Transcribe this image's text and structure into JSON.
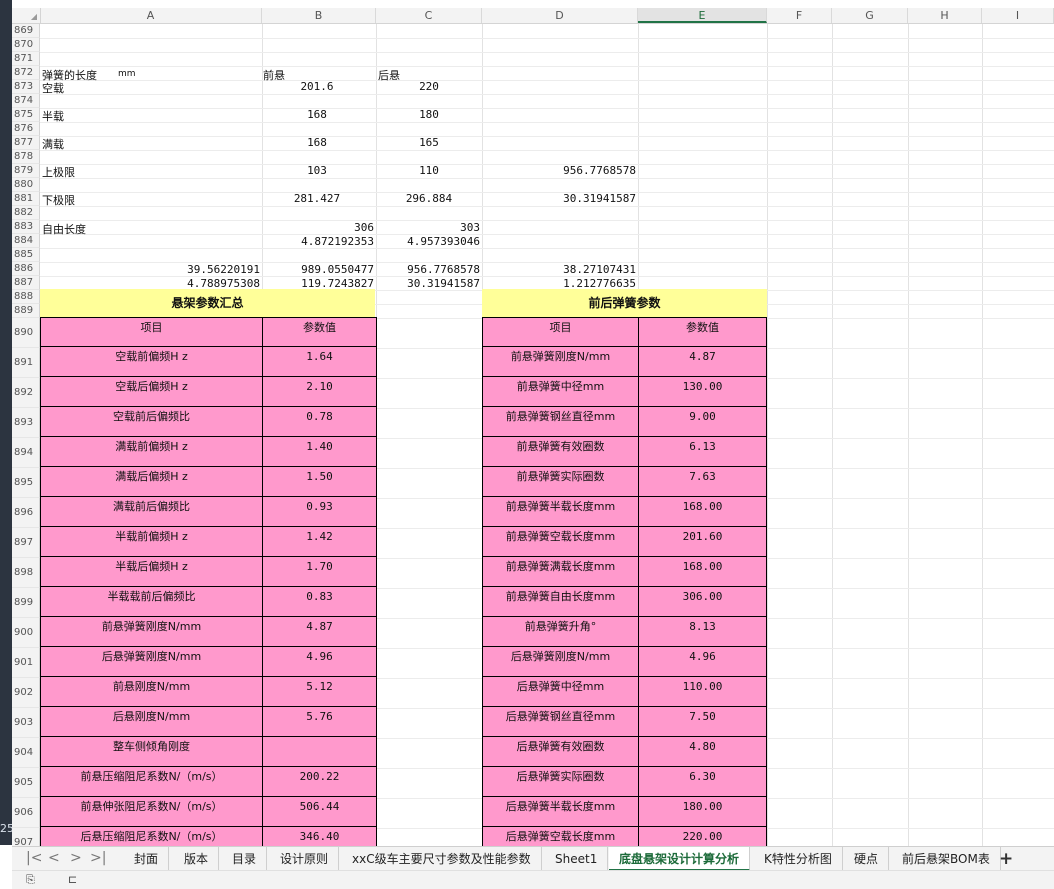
{
  "grid": {
    "columns": [
      "A",
      "B",
      "C",
      "D",
      "E",
      "F",
      "G",
      "H",
      "I"
    ],
    "selected_column": "E",
    "rows": [
      "869",
      "870",
      "871",
      "872",
      "873",
      "874",
      "875",
      "876",
      "877",
      "878",
      "879",
      "880",
      "881",
      "882",
      "883",
      "884",
      "885",
      "886",
      "887",
      "888",
      "889",
      "890",
      "891",
      "892",
      "893",
      "894",
      "895",
      "896",
      "897",
      "898",
      "899",
      "900",
      "901",
      "902",
      "903",
      "904",
      "905",
      "906",
      "907"
    ]
  },
  "spring_length": {
    "label": "弹簧的长度",
    "unit": "mm",
    "front_label": "前悬",
    "rear_label": "后悬",
    "rows": [
      {
        "label": "空载",
        "front": "201.6",
        "rear": "220",
        "extra": ""
      },
      {
        "label": "半载",
        "front": "168",
        "rear": "180",
        "extra": ""
      },
      {
        "label": "满载",
        "front": "168",
        "rear": "165",
        "extra": ""
      },
      {
        "label": "上极限",
        "front": "103",
        "rear": "110",
        "extra": "956.7768578"
      },
      {
        "label": "下极限",
        "front": "281.427",
        "rear": "296.884",
        "extra": "30.31941587"
      }
    ],
    "free_label": "自由长度",
    "free_front": "306",
    "free_rear": "303",
    "r884_b": "4.872192353",
    "r884_c": "4.957393046",
    "r886": [
      "39.56220191",
      "989.0550477",
      "956.7768578",
      "38.27107431"
    ],
    "r887": [
      "4.788975308",
      "119.7243827",
      "30.31941587",
      "1.212776635"
    ]
  },
  "summary_table": {
    "title": "悬架参数汇总",
    "col_item": "项目",
    "col_value": "参数值",
    "rows": [
      {
        "name": "空载前偏频H z",
        "value": "1.64"
      },
      {
        "name": "空载后偏频H z",
        "value": "2.10"
      },
      {
        "name": "空载前后偏频比",
        "value": "0.78"
      },
      {
        "name": "满载前偏频H z",
        "value": "1.40"
      },
      {
        "name": "满载后偏频H z",
        "value": "1.50"
      },
      {
        "name": "满载前后偏频比",
        "value": "0.93"
      },
      {
        "name": "半载前偏频H z",
        "value": "1.42"
      },
      {
        "name": "半载后偏频H z",
        "value": "1.70"
      },
      {
        "name": "半载载前后偏频比",
        "value": "0.83"
      },
      {
        "name": "前悬弹簧刚度N/mm",
        "value": "4.87"
      },
      {
        "name": "后悬弹簧刚度N/mm",
        "value": "4.96"
      },
      {
        "name": "前悬刚度N/mm",
        "value": "5.12"
      },
      {
        "name": "后悬刚度N/mm",
        "value": "5.76"
      },
      {
        "name": "整车侧倾角刚度",
        "value": ""
      },
      {
        "name": "前悬压缩阻尼系数N/（m/s）",
        "value": "200.22"
      },
      {
        "name": "前悬伸张阻尼系数N/（m/s）",
        "value": "506.44"
      },
      {
        "name": "后悬压缩阻尼系数N/（m/s）",
        "value": "346.40"
      }
    ]
  },
  "spring_table": {
    "title": "前后弹簧参数",
    "col_item": "项目",
    "col_value": "参数值",
    "rows": [
      {
        "name": "前悬弹簧刚度N/mm",
        "value": "4.87"
      },
      {
        "name": "前悬弹簧中径mm",
        "value": "130.00"
      },
      {
        "name": "前悬弹簧钢丝直径mm",
        "value": "9.00"
      },
      {
        "name": "前悬弹簧有效圈数",
        "value": "6.13"
      },
      {
        "name": "前悬弹簧实际圈数",
        "value": "7.63"
      },
      {
        "name": "前悬弹簧半载长度mm",
        "value": "168.00"
      },
      {
        "name": "前悬弹簧空载长度mm",
        "value": "201.60"
      },
      {
        "name": "前悬弹簧满载长度mm",
        "value": "168.00"
      },
      {
        "name": "前悬弹簧自由长度mm",
        "value": "306.00"
      },
      {
        "name": "前悬弹簧升角°",
        "value": "8.13"
      },
      {
        "name": "后悬弹簧刚度N/mm",
        "value": "4.96"
      },
      {
        "name": "后悬弹簧中径mm",
        "value": "110.00"
      },
      {
        "name": "后悬弹簧钢丝直径mm",
        "value": "7.50"
      },
      {
        "name": "后悬弹簧有效圈数",
        "value": "4.80"
      },
      {
        "name": "后悬弹簧实际圈数",
        "value": "6.30"
      },
      {
        "name": "后悬弹簧半载长度mm",
        "value": "180.00"
      },
      {
        "name": "后悬弹簧空载长度mm",
        "value": "220.00"
      }
    ]
  },
  "sheet_tabs": [
    "封面",
    "版本",
    "目录",
    "设计原则",
    "xxC级车主要尺寸参数及性能参数",
    "Sheet1",
    "底盘悬架设计计算分析",
    "K特性分析图",
    "硬点",
    "前后悬架BOM表"
  ],
  "active_tab": "底盘悬架设计计算分析",
  "add_tab_label": "+",
  "left_strip_text": "25",
  "colors": {
    "table_fill": "#ff99cc",
    "title_fill": "#ffff99",
    "accent": "#217346"
  }
}
